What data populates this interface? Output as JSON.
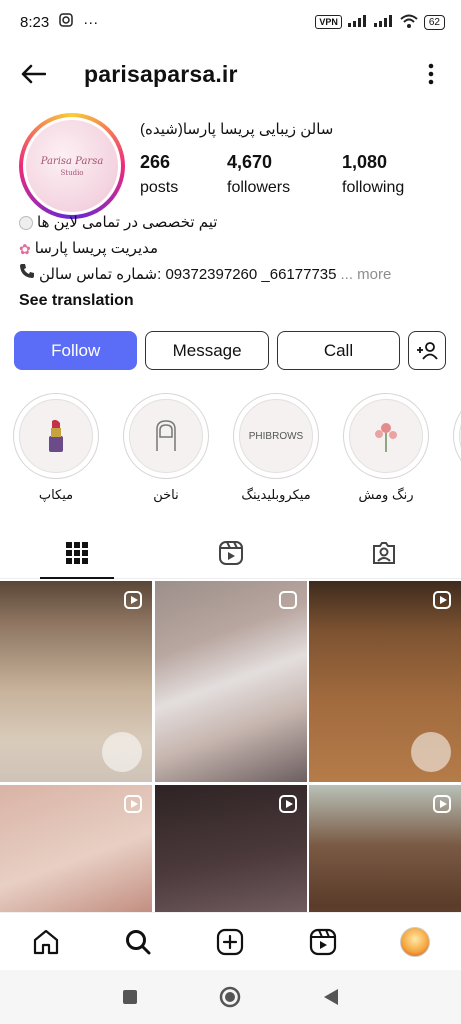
{
  "status_bar": {
    "time": "8:23",
    "vpn": "VPN",
    "battery": "62"
  },
  "header": {
    "username": "parisaparsa.ir"
  },
  "profile": {
    "avatar_brand": "Parisa Parsa",
    "avatar_sub": "Studio",
    "name": "سالن زیبایی پریسا پارسا(شیده)",
    "stats": [
      {
        "value": "266",
        "label": "posts"
      },
      {
        "value": "4,670",
        "label": "followers"
      },
      {
        "value": "1,080",
        "label": "following"
      }
    ],
    "bio": {
      "line1": "تیم تخصصی در تمامی لاین ها",
      "line2": "مدیریت پریسا پارسا",
      "line3": "66177735_ 09372397260 :شماره تماس سالن",
      "more": "... more",
      "see_translation": "See translation"
    }
  },
  "actions": {
    "follow": "Follow",
    "message": "Message",
    "call": "Call"
  },
  "highlights": [
    {
      "label": "میکاپ",
      "icon": "lipstick-icon",
      "inner": "💄"
    },
    {
      "label": "ناخن",
      "icon": "nail-icon",
      "inner": ""
    },
    {
      "label": "میکروبلیدینگ",
      "icon": "phibrows-icon",
      "inner": "PHIBROWS"
    },
    {
      "label": "رنگ ومش",
      "icon": "flower-icon",
      "inner": "✿"
    }
  ],
  "colors": {
    "follow_button": "#5b6cf7",
    "avatar_ring": "#ee2a7b"
  }
}
